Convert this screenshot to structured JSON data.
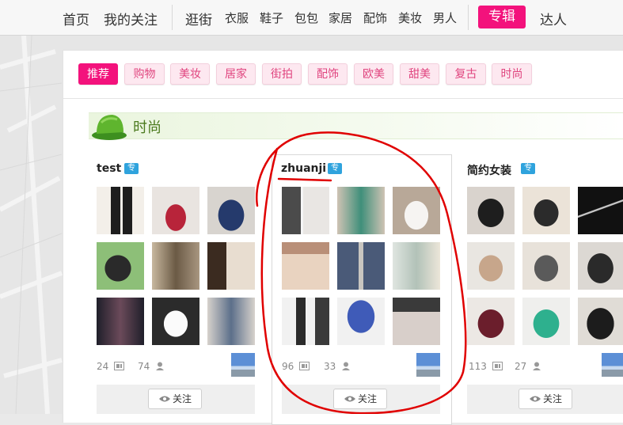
{
  "topnav": {
    "home": "首页",
    "my_follow": "我的关注",
    "categories": [
      "逛街",
      "衣服",
      "鞋子",
      "包包",
      "家居",
      "配饰",
      "美妆",
      "男人"
    ],
    "featured": "专辑",
    "experts": "达人"
  },
  "tags": [
    "推荐",
    "购物",
    "美妆",
    "居家",
    "街拍",
    "配饰",
    "欧美",
    "甜美",
    "复古",
    "时尚"
  ],
  "section": {
    "title": "时尚"
  },
  "collections": [
    {
      "title": "test",
      "badge": "专",
      "pics": "24",
      "followers": "74",
      "follow_label": "关注"
    },
    {
      "title": "zhuanji",
      "badge": "专",
      "pics": "96",
      "followers": "33",
      "follow_label": "关注"
    },
    {
      "title": "简约女装",
      "badge": "专",
      "pics": "113",
      "followers": "27",
      "follow_label": "关注"
    }
  ],
  "colors": {
    "brand_pink": "#f3127c",
    "tag_bg": "#fde8f0",
    "section_green": "#4b7a1e",
    "badge_blue": "#2fa3dd",
    "annotation_red": "#e00000"
  }
}
